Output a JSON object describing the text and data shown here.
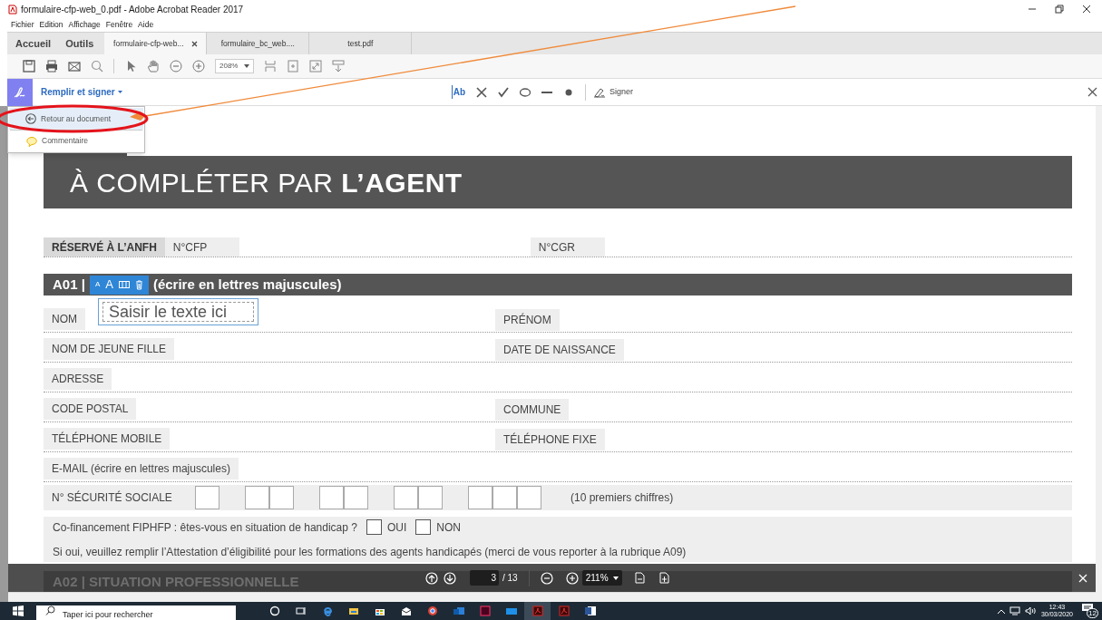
{
  "window": {
    "title": "formulaire-cfp-web_0.pdf - Adobe Acrobat Reader 2017"
  },
  "menu": [
    "Fichier",
    "Edition",
    "Affichage",
    "Fenêtre",
    "Aide"
  ],
  "home_tabs": [
    "Accueil",
    "Outils"
  ],
  "tabs": [
    {
      "label": "formulaire-cfp-web...",
      "selected": true,
      "closable": true
    },
    {
      "label": "formulaire_bc_web....",
      "selected": false,
      "closable": false
    },
    {
      "label": "test.pdf",
      "selected": false,
      "closable": false
    }
  ],
  "toolbar": {
    "zoom": "208%"
  },
  "fill_sign": {
    "title": "Remplir et signer",
    "text_tool": "Ab",
    "sign_label": "Signer"
  },
  "dropdown": [
    {
      "label": "Retour au document",
      "kind": "back",
      "selected": true
    },
    {
      "label": "Commentaire",
      "kind": "comment",
      "selected": false
    }
  ],
  "document": {
    "banner_light": "À COMPLÉTER PAR",
    "banner_bold": "L’AGENT",
    "reserved": {
      "label": "RÉSERVÉ À L’ANFH",
      "fields": [
        "N°CFP",
        "N°CGR"
      ]
    },
    "section": {
      "code": "A01 |",
      "note": "(écrire en lettres majuscules)",
      "format_buttons": [
        "A",
        "A"
      ]
    },
    "text_field": {
      "placeholder": "Saisir le texte ici"
    },
    "rows": [
      [
        "NOM",
        "PRÉNOM"
      ],
      [
        "NOM DE JEUNE FILLE",
        "DATE DE NAISSANCE"
      ],
      [
        "ADRESSE"
      ],
      [
        "CODE POSTAL",
        "COMMUNE"
      ],
      [
        "TÉLÉPHONE MOBILE",
        "TÉLÉPHONE FIXE"
      ],
      [
        "E-MAIL (écrire en lettres majuscules)"
      ]
    ],
    "secu": {
      "label": "N° SÉCURITÉ SOCIALE",
      "note": "(10 premiers chiffres)"
    },
    "cofinancement": {
      "question": "Co-financement FIPHFP : êtes-vous en situation de handicap ?",
      "options": [
        {
          "label": "OUI",
          "checked": false
        },
        {
          "label": "NON",
          "checked": false
        }
      ],
      "note": "Si oui, veuillez remplir l’Attestation d’éligibilité pour les formations des agents handicapés (merci de vous reporter à la rubrique A09)"
    },
    "next_section": "A02 | SITUATION PROFESSIONNELLE"
  },
  "nav": {
    "page": "3",
    "total": "/ 13",
    "zoom": "211%"
  },
  "taskbar": {
    "search_placeholder": "Taper ici pour rechercher",
    "time": "12:43",
    "date": "30/03/2020",
    "notifications": "12"
  }
}
